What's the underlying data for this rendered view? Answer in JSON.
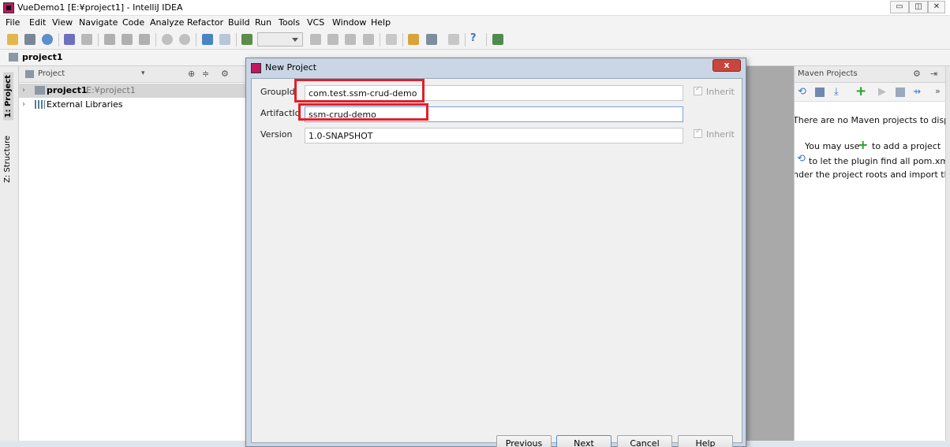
{
  "window": {
    "title": "VueDemo1 [E:¥project1] - IntelliJ IDEA"
  },
  "menu": [
    "File",
    "Edit",
    "View",
    "Navigate",
    "Code",
    "Analyze",
    "Refactor",
    "Build",
    "Run",
    "Tools",
    "VCS",
    "Window",
    "Help"
  ],
  "toolbar": {
    "icons": [
      "open-folder-icon",
      "save-icon",
      "sync-icon",
      "undo-icon",
      "redo-icon",
      "cut-icon",
      "copy-icon",
      "paste-icon",
      "find-icon",
      "replace-icon",
      "back-icon",
      "forward-icon",
      "build-icon",
      "run-icon",
      "debug-icon",
      "coverage-icon",
      "stop-icon",
      "vcs-icon",
      "project-structure-icon",
      "settings-icon",
      "sdk-icon",
      "help-icon",
      "terminal-icon"
    ]
  },
  "navbar": {
    "crumb": "project1"
  },
  "left_tabs": {
    "project": "1: Project",
    "structure": "Z: Structure"
  },
  "project_panel": {
    "header": "Project",
    "rows": [
      {
        "label": "project1",
        "path": "E:¥project1"
      },
      {
        "label": "External Libraries"
      }
    ]
  },
  "dialog": {
    "title": "New Project",
    "close_label": "x",
    "fields": {
      "group_id": {
        "label": "GroupId",
        "value": "com.test.ssm-crud-demo",
        "inherit": "Inherit"
      },
      "artifact_id": {
        "label": "ArtifactId",
        "value": "ssm-crud-demo"
      },
      "version": {
        "label": "Version",
        "value": "1.0-SNAPSHOT",
        "inherit": "Inherit"
      }
    },
    "buttons": {
      "previous": "Previous",
      "next": "Next",
      "cancel": "Cancel",
      "help": "Help"
    }
  },
  "maven": {
    "header": "Maven Projects",
    "line1": "There are no Maven projects to displ",
    "line2a": "You may use",
    "line2b": "to add a project",
    "line3": "to let the plugin find all pom.xml",
    "line4": "nder the project roots and import th"
  },
  "colors": {
    "highlight_box": "#e0202a",
    "dialog_frame": "#cad6e5",
    "editor_background": "#a9a9a9"
  }
}
